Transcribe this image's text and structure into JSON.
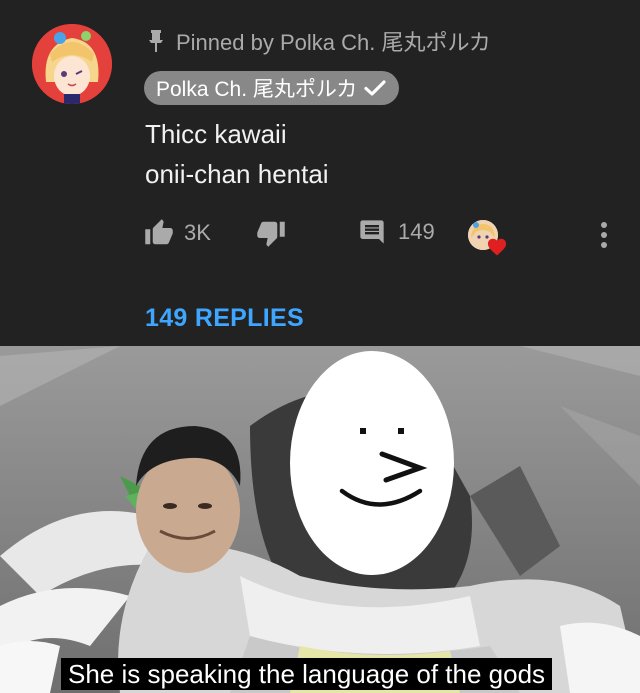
{
  "comment": {
    "pinned_text": "Pinned by Polka Ch. 尾丸ポルカ",
    "author_name": "Polka Ch. 尾丸ポルカ",
    "text_lines": [
      "Thicc kawaii",
      "onii-chan hentai"
    ],
    "like_count": "3K",
    "reply_count": "149",
    "replies_link": "149 REPLIES",
    "icons": {
      "pin": "pin-icon",
      "verified": "checkmark-icon",
      "like": "thumbs-up-icon",
      "dislike": "thumbs-down-icon",
      "reply": "comment-icon",
      "creator_heart": "heart-icon",
      "more": "more-vert-icon"
    },
    "colors": {
      "background": "#222222",
      "secondary_text": "#aaaaaa",
      "replies_link": "#3ea6ff",
      "heart": "#e02020"
    }
  },
  "meme": {
    "subtitle": "She is speaking the language of the gods"
  }
}
